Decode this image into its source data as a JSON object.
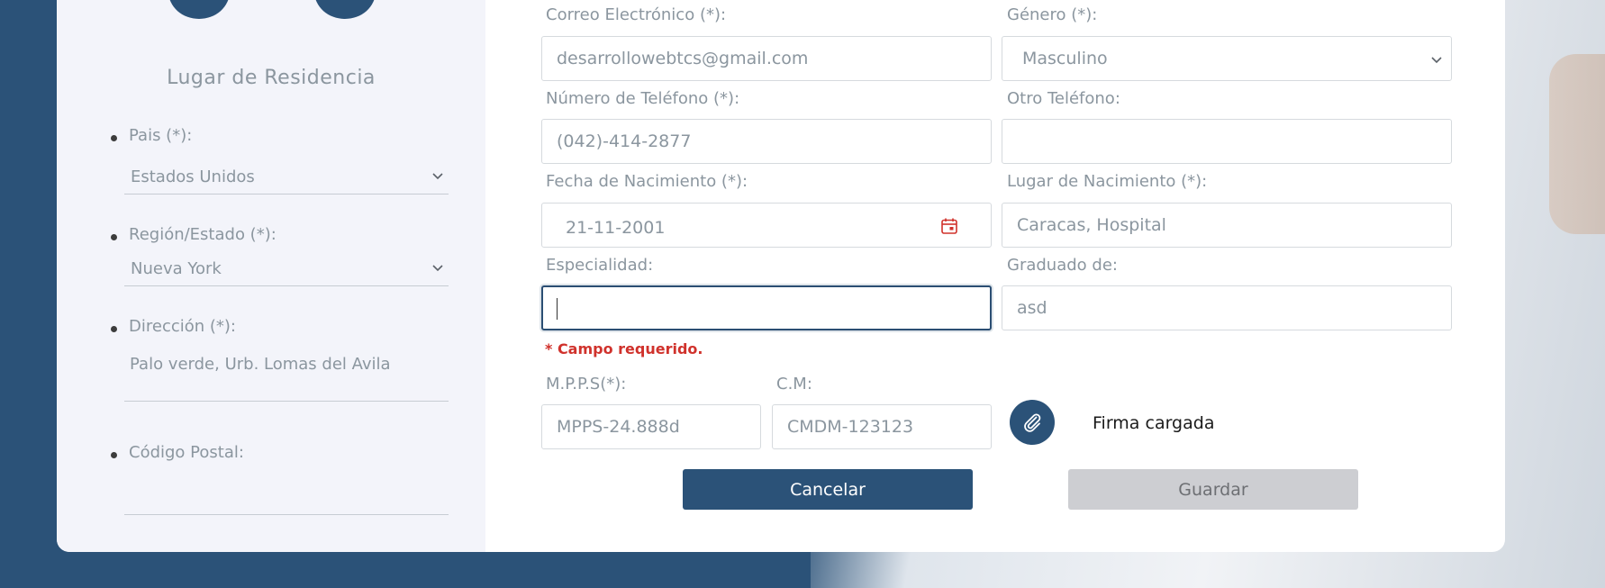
{
  "sidebar": {
    "title": "Lugar de Residencia",
    "items": [
      {
        "label": "Pais (*):",
        "value": "Estados Unidos"
      },
      {
        "label": "Región/Estado (*):",
        "value": "Nueva York"
      },
      {
        "label": "Dirección (*):",
        "value": "Palo verde, Urb. Lomas del Avila"
      },
      {
        "label": "Código Postal:",
        "value": ""
      }
    ]
  },
  "form": {
    "email": {
      "label": "Correo Electrónico (*):",
      "value": "desarrollowebtcs@gmail.com"
    },
    "gender": {
      "label": "Género (*):",
      "value": "Masculino"
    },
    "phone": {
      "label": "Número de Teléfono (*):",
      "value": "(042)-414-2877"
    },
    "other_phone": {
      "label": "Otro Teléfono:",
      "value": ""
    },
    "birth_date": {
      "label": "Fecha de Nacimiento (*):",
      "value": "21-11-2001"
    },
    "birth_place": {
      "label": "Lugar de Nacimiento (*):",
      "value": "Caracas, Hospital"
    },
    "specialty": {
      "label": "Especialidad:",
      "value": "",
      "error": "* Campo requerido."
    },
    "graduated": {
      "label": "Graduado de:",
      "value": "asd"
    },
    "mpps": {
      "label": "M.P.P.S(*):",
      "value": "MPPS-24.888d"
    },
    "cm": {
      "label": "C.M:",
      "value": "CMDM-123123"
    },
    "signature_status": "Firma cargada"
  },
  "buttons": {
    "cancel": "Cancelar",
    "save": "Guardar"
  },
  "colors": {
    "brand": "#2b5278",
    "error": "#d0322c",
    "disabled": "#cdced2"
  },
  "icons": {
    "calendar": "calendar-icon",
    "chevron": "chevron-down-icon",
    "clip": "paperclip-icon"
  }
}
